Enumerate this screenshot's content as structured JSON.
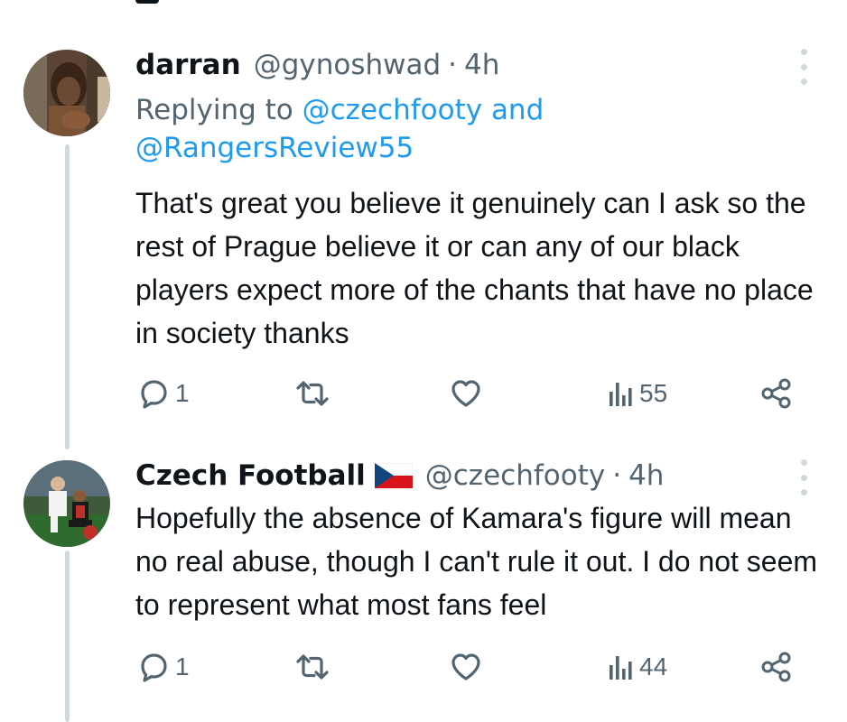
{
  "tweets": [
    {
      "display_name": "darran",
      "handle": "@gynoshwad",
      "separator": "·",
      "time": "4h",
      "reply_prefix": "Replying to",
      "reply_mention_1": "@czechfooty",
      "reply_and": "and",
      "reply_mention_2": "@RangersReview55",
      "body": "That's great you believe it genuinely can I ask so the rest of Prague believe it or can any of our black players expect more of the chants that have no place in society thanks",
      "reply_count": "1",
      "view_count": "55"
    },
    {
      "display_name": "Czech Football",
      "flag_icon": "czech-flag-icon",
      "handle": "@czechfooty",
      "separator": "·",
      "time": "4h",
      "body": "Hopefully the absence of Kamara's figure will mean no real abuse, though I can't rule it out. I do not seem to represent what most fans feel",
      "reply_count": "1",
      "view_count": "44"
    }
  ],
  "colors": {
    "text_primary": "#0f1419",
    "text_secondary": "#536471",
    "link": "#1d9bf0",
    "thread_line": "#cfd9de"
  }
}
